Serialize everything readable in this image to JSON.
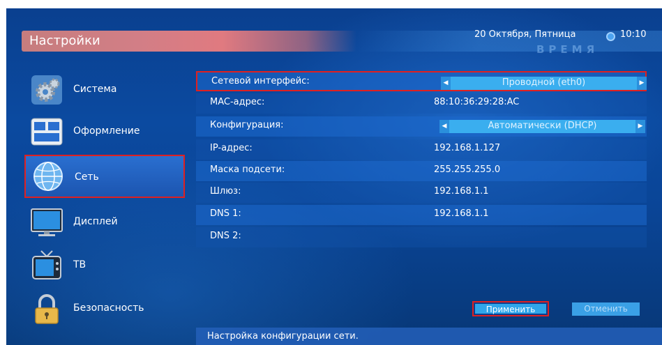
{
  "header": {
    "title": "Настройки",
    "date": "20 Октября, Пятница",
    "time": "10:10",
    "watermark": "ВРЕМЯ"
  },
  "sidebar": {
    "items": [
      {
        "label": "Система",
        "icon": "gear-icon",
        "selected": false
      },
      {
        "label": "Оформление",
        "icon": "appearance-icon",
        "selected": false
      },
      {
        "label": "Сеть",
        "icon": "globe-icon",
        "selected": true
      },
      {
        "label": "Дисплей",
        "icon": "display-icon",
        "selected": false
      },
      {
        "label": "ТВ",
        "icon": "tv-icon",
        "selected": false
      },
      {
        "label": "Безопасность",
        "icon": "lock-icon",
        "selected": false
      }
    ]
  },
  "network": {
    "rows": [
      {
        "label": "Сетевой интерфейс:",
        "value": "Проводной (eth0)",
        "type": "selector"
      },
      {
        "label": "MAC-адрес:",
        "value": "88:10:36:29:28:AC",
        "type": "text"
      },
      {
        "label": "Конфигурация:",
        "value": "Автоматически (DHCP)",
        "type": "selector"
      },
      {
        "label": "IP-адрес:",
        "value": "192.168.1.127",
        "type": "text"
      },
      {
        "label": "Маска подсети:",
        "value": "255.255.255.0",
        "type": "text"
      },
      {
        "label": "Шлюз:",
        "value": "192.168.1.1",
        "type": "text"
      },
      {
        "label": "DNS 1:",
        "value": "192.168.1.1",
        "type": "text"
      },
      {
        "label": "DNS 2:",
        "value": "",
        "type": "text"
      }
    ]
  },
  "buttons": {
    "apply": "Применить",
    "cancel": "Отменить"
  },
  "status": {
    "text": "Настройка конфигурации сети."
  },
  "colors": {
    "background": "#0b4aa0",
    "highlight": "#e02020",
    "selector": "#3aaeef",
    "title_bar": "#d27e86"
  }
}
